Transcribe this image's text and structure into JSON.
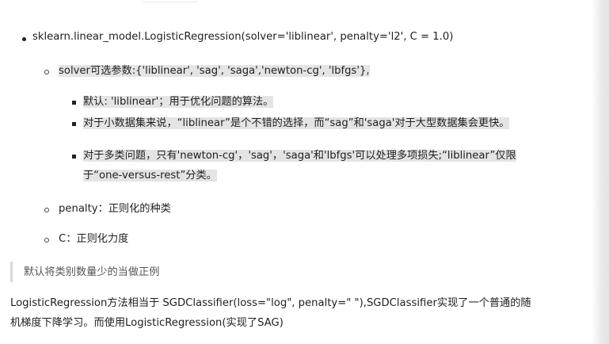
{
  "items": {
    "l1": "sklearn.linear_model.LogisticRegression(solver='liblinear', penalty='l2', C = 1.0)",
    "l2": "solver可选参数:{'liblinear', 'sag', 'saga','newton-cg', 'lbfgs'},",
    "l3": "默认: 'liblinear'；用于优化问题的算法。",
    "l4": "对于小数据集来说，“liblinear”是个不错的选择，而“sag”和'saga'对于大型数据集会更快。",
    "l5a": "对于多类问题，只有'newton-cg'，'sag'，'saga'和'lbfgs'可以处理多项损失;“liblinear”仅限",
    "l5b": "于“one-versus-rest”分类。",
    "l6": "penalty：正则化的种类",
    "l7": "C：正则化力度"
  },
  "quote": "默认将类别数量少的当做正例",
  "paragraph": {
    "line1": "LogisticRegression方法相当于 SGDClassifier(loss=\"log\", penalty=\" \"),SGDClassifier实现了一个普通的随",
    "line2": "机梯度下降学习。而使用LogisticRegression(实现了SAG)"
  },
  "colors": {
    "highlight": "#e4e4e4",
    "quote_bar": "#d7d7d7",
    "text": "#1f1f1f"
  }
}
